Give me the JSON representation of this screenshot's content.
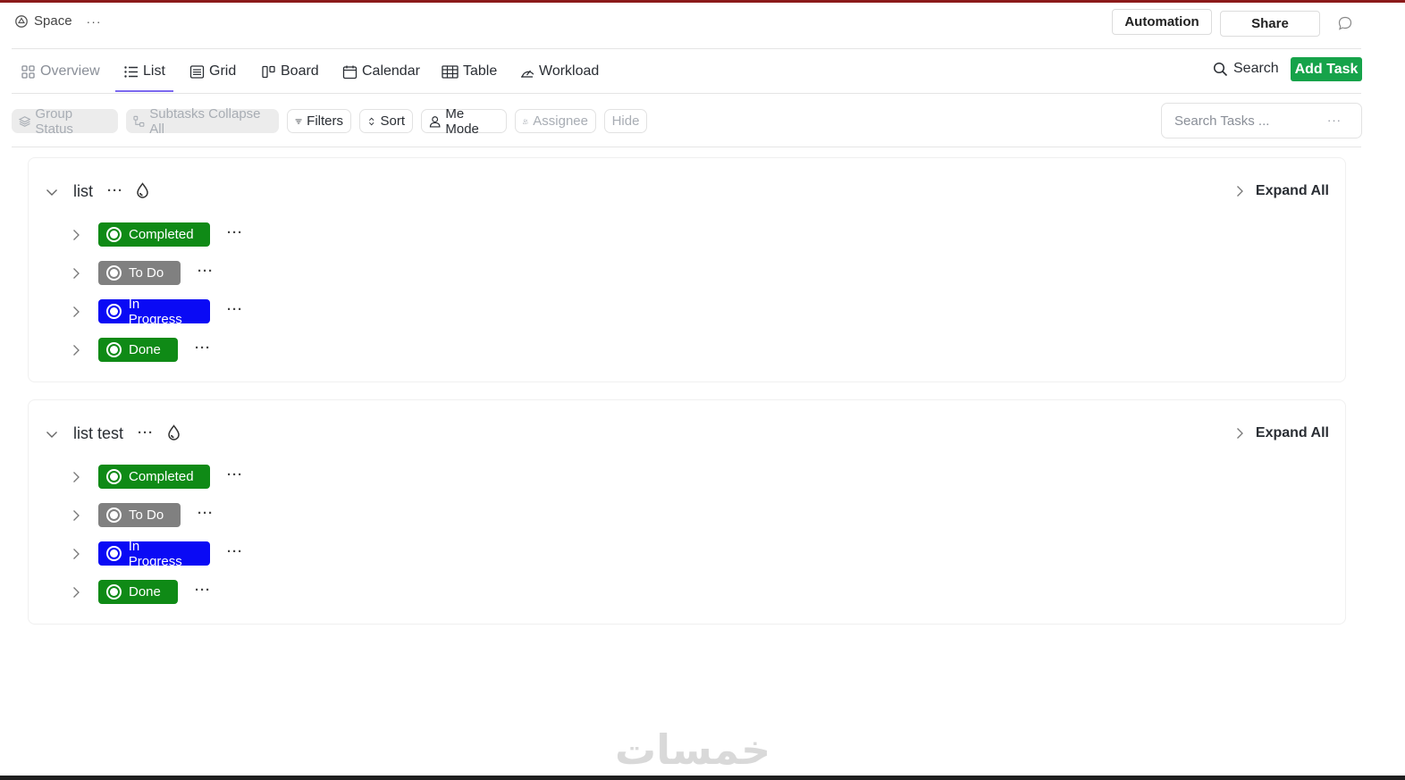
{
  "header": {
    "space_label": "Space",
    "space_more": "···",
    "automation_label": "Automation",
    "share_label": "Share"
  },
  "tabs": [
    {
      "label": "Overview",
      "icon": "overview-icon"
    },
    {
      "label": "List",
      "icon": "list-icon",
      "active": true
    },
    {
      "label": "Grid",
      "icon": "grid-icon"
    },
    {
      "label": "Board",
      "icon": "board-icon"
    },
    {
      "label": "Calendar",
      "icon": "calendar-icon"
    },
    {
      "label": "Table",
      "icon": "table-icon"
    },
    {
      "label": "Workload",
      "icon": "workload-icon"
    }
  ],
  "actions": {
    "search_label": "Search",
    "add_task_label": "Add Task"
  },
  "filters": {
    "group_status": "Group Status",
    "subtasks": "Subtasks Collapse All",
    "filters": "Filters",
    "sort": "Sort",
    "me_mode": "Me Mode",
    "assignee": "Assignee",
    "hide": "Hide",
    "search_placeholder": "Search Tasks ...",
    "search_more": "···"
  },
  "lists": [
    {
      "title": "list",
      "expand_label": "Expand All",
      "statuses": [
        {
          "label": "Completed",
          "color": "#0f8a16"
        },
        {
          "label": "To Do",
          "color": "#808080"
        },
        {
          "label": "In Progress",
          "color": "#0a0af5"
        },
        {
          "label": "Done",
          "color": "#0f8a16"
        }
      ]
    },
    {
      "title": "list test",
      "expand_label": "Expand All",
      "statuses": [
        {
          "label": "Completed",
          "color": "#0f8a16"
        },
        {
          "label": "To Do",
          "color": "#808080"
        },
        {
          "label": "In Progress",
          "color": "#0a0af5"
        },
        {
          "label": "Done",
          "color": "#0f8a16"
        }
      ]
    }
  ],
  "more_glyph": "···",
  "watermark": "خمسات",
  "colors": {
    "accent": "#7b68ee",
    "add_task": "#16a34a",
    "top_accent": "#8b1a1a"
  }
}
